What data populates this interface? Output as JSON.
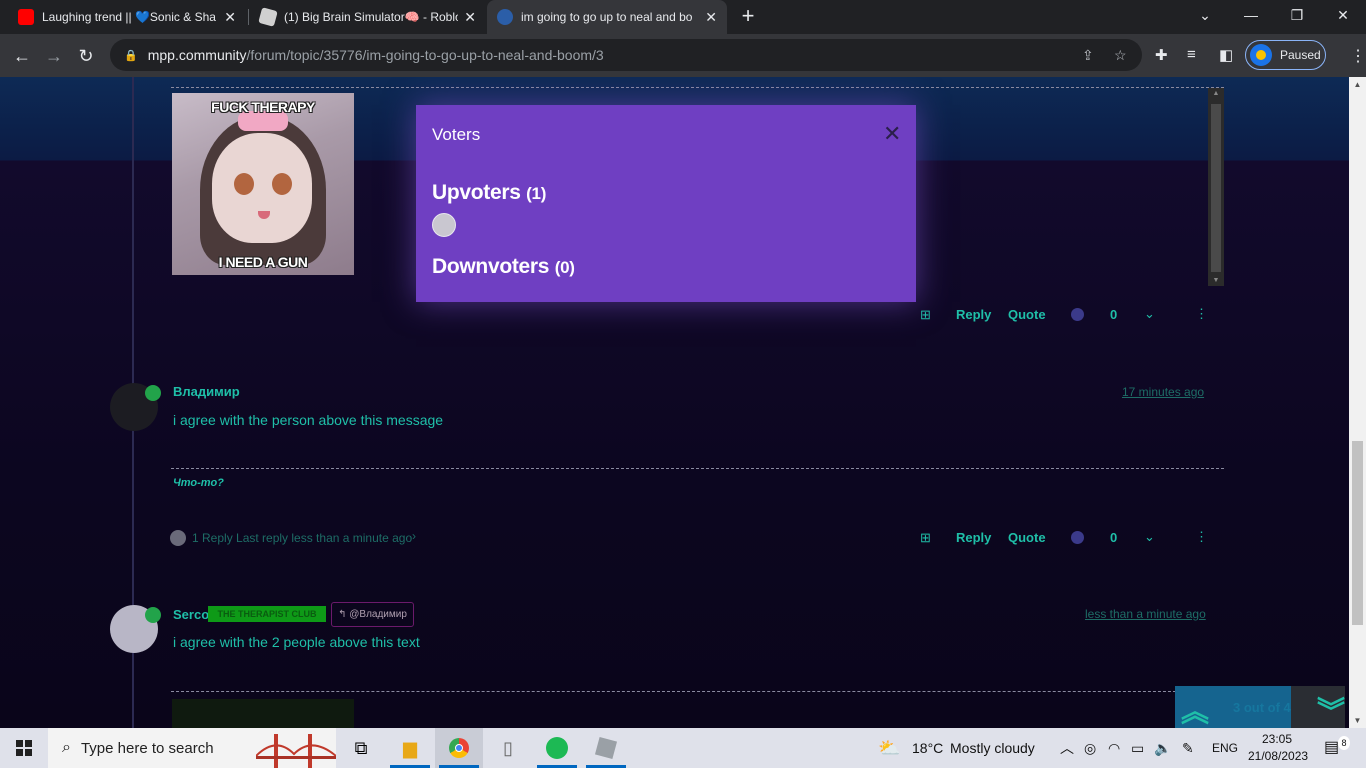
{
  "browser": {
    "tabs": [
      {
        "title": "Laughing trend || 💙Sonic & Sha",
        "favicon": "youtube-icon",
        "active": false
      },
      {
        "title": "(1) Big Brain Simulator🧠 - Roblo",
        "favicon": "roblox-icon",
        "active": false
      },
      {
        "title": "im going to go up to neal and bo",
        "favicon": "mpp-icon",
        "active": true
      }
    ],
    "url_host": "mpp.community",
    "url_path": "/forum/topic/35776/im-going-to-go-up-to-neal-and-boom/3",
    "profile_label": "Paused"
  },
  "posts": [
    {
      "image_top_caption": "FUCK THERAPY",
      "image_bottom_caption": "I NEED A GUN",
      "actions": {
        "reply": "Reply",
        "quote": "Quote",
        "votes": "0"
      }
    },
    {
      "username": "Владимир",
      "time": "17 minutes ago",
      "text": "i agree with the person above this message",
      "signature": "Что-то?",
      "replies": "1 Reply Last reply less than a minute ago",
      "actions": {
        "reply": "Reply",
        "quote": "Quote",
        "votes": "0"
      }
    },
    {
      "username": "Serco",
      "badge": "THE THERAPIST CLUB",
      "reply_to": "@Владимир",
      "time": "less than a minute ago",
      "text": "i agree with the 2 people above this text"
    }
  ],
  "pagination": {
    "label": "3 out of 4"
  },
  "voters_modal": {
    "title": "Voters",
    "upvoters_label": "Upvoters",
    "upvoters_count": "(1)",
    "downvoters_label": "Downvoters",
    "downvoters_count": "(0)"
  },
  "taskbar": {
    "search_placeholder": "Type here to search",
    "weather_temp": "18°C",
    "weather_desc": "Mostly cloudy",
    "language": "ENG",
    "time": "23:05",
    "date": "21/08/2023",
    "notifications": "8"
  },
  "colors": {
    "modal_bg": "#6f3fc2",
    "accent_teal": "#1fbfa8",
    "page_bg": "#0d0720"
  }
}
